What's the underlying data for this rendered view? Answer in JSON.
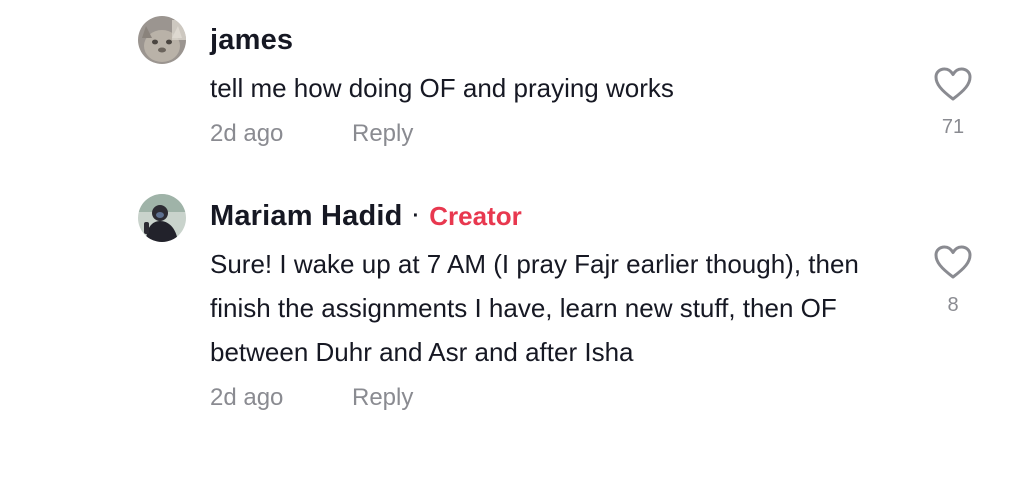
{
  "comments": [
    {
      "username": "james",
      "is_creator": false,
      "text": "tell me how doing OF and praying works",
      "time": "2d ago",
      "reply_label": "Reply",
      "likes": "71",
      "avatar_icon": "cat-avatar-icon"
    },
    {
      "username": "Mariam Hadid",
      "is_creator": true,
      "creator_separator": "·",
      "creator_label": "Creator",
      "text": "Sure! I wake up at 7 AM (I pray Fajr earlier though), then finish the assignments I have, learn new stuff, then OF between Duhr and Asr and after Isha",
      "time": "2d ago",
      "reply_label": "Reply",
      "likes": "8",
      "avatar_icon": "person-avatar-icon"
    }
  ],
  "colors": {
    "primary_text": "#161823",
    "secondary_text": "#8a8b91",
    "creator_accent": "#e8384f",
    "icon_stroke": "#8a8b91"
  },
  "icons": {
    "like": "heart-outline-icon"
  }
}
